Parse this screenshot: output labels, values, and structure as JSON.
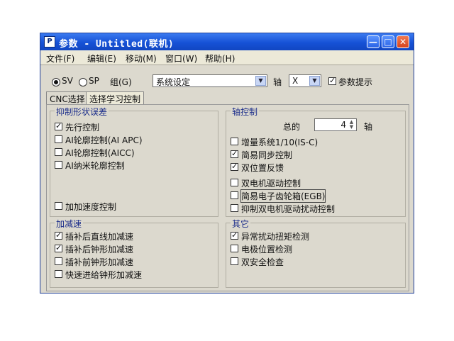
{
  "window": {
    "title": "参数 - Untitled(联机)",
    "app_icon_letter": "P",
    "buttons": {
      "minimize": "—",
      "maximize": "□",
      "close": "✕"
    }
  },
  "menu": [
    "文件(F)",
    "编辑(E)",
    "移动(M)",
    "窗口(W)",
    "帮助(H)"
  ],
  "toolbar": {
    "sv_label": "SV",
    "sp_label": "SP",
    "sv_selected": true,
    "group_label": "组(G)",
    "group_combo_value": "系统设定",
    "axis_label": "轴",
    "axis_combo_value": "X",
    "param_hint_label": "参数提示",
    "param_hint_checked": true
  },
  "tabs": [
    {
      "label": "CNC选择",
      "active": true
    },
    {
      "label": "选择学习控制",
      "active": false
    }
  ],
  "groups": {
    "contour_error": {
      "title": "抑制形状误差",
      "items": [
        {
          "label": "先行控制",
          "checked": true
        },
        {
          "label": "AI轮廓控制(AI APC)",
          "checked": false
        },
        {
          "label": "AI轮廓控制(AICC)",
          "checked": false
        },
        {
          "label": "AI纳米轮廓控制",
          "checked": false
        },
        {
          "label": "加加速度控制",
          "checked": false
        }
      ]
    },
    "axis_control": {
      "title": "轴控制",
      "total_label": "总的",
      "total_value": "4",
      "total_unit": "轴",
      "items": [
        {
          "label": "增量系统1/10(IS-C)",
          "checked": false
        },
        {
          "label": "简易同步控制",
          "checked": true
        },
        {
          "label": "双位置反馈",
          "checked": true
        },
        {
          "label": "双电机驱动控制",
          "checked": false
        },
        {
          "label": "简易电子齿轮箱(EGB)",
          "checked": false
        },
        {
          "label": "抑制双电机驱动扰动控制",
          "checked": false
        }
      ]
    },
    "accel": {
      "title": "加减速",
      "items": [
        {
          "label": "插补后直线加减速",
          "checked": true
        },
        {
          "label": "插补后钟形加减速",
          "checked": true
        },
        {
          "label": "插补前钟形加减速",
          "checked": false
        },
        {
          "label": "快速进给钟形加减速",
          "checked": false
        }
      ]
    },
    "other": {
      "title": "其它",
      "items": [
        {
          "label": "异常扰动扭矩检测",
          "checked": true
        },
        {
          "label": "电极位置检测",
          "checked": false
        },
        {
          "label": "双安全检查",
          "checked": false
        }
      ]
    }
  }
}
